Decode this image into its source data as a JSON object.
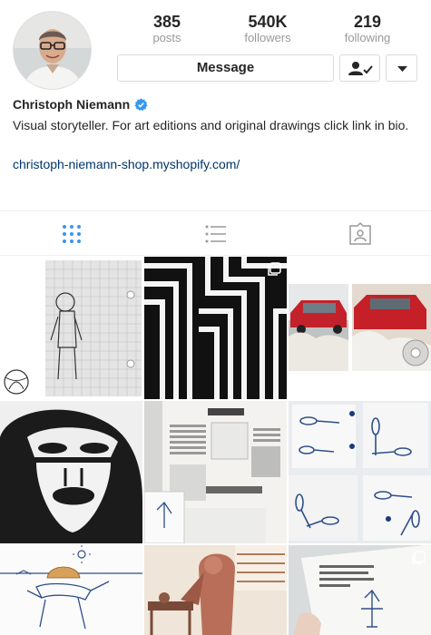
{
  "profile": {
    "name": "Christoph Niemann",
    "verified": true,
    "bio": "Visual storyteller. For art editions and original drawings click link in bio.",
    "link": "christoph-niemann-shop.myshopify.com/"
  },
  "stats": [
    {
      "value": "385",
      "label": "posts"
    },
    {
      "value": "540K",
      "label": "followers"
    },
    {
      "value": "219",
      "label": "following"
    }
  ],
  "actions": {
    "message_label": "Message",
    "following_icon": "person-check-icon",
    "more_icon": "caret-down-icon"
  },
  "tabs": [
    {
      "name": "grid",
      "icon": "grid-icon",
      "active": true
    },
    {
      "name": "list",
      "icon": "list-icon",
      "active": false
    },
    {
      "name": "tagged",
      "icon": "tagged-icon",
      "active": false
    }
  ],
  "colors": {
    "accent": "#3897f0",
    "link": "#003569",
    "secondary_text": "#999999",
    "border": "#dbdbdb"
  }
}
